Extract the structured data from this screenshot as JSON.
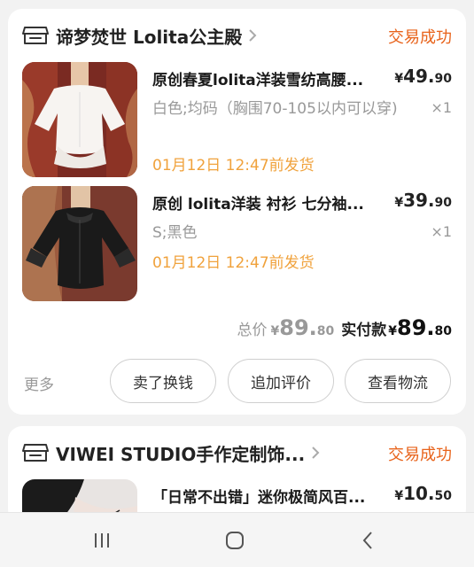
{
  "orders": [
    {
      "shop_name": "谛梦焚世  Lolita公主殿",
      "status": "交易成功",
      "items": [
        {
          "title": "原创春夏lolita洋装雪纺高腰...",
          "price_symbol": "¥",
          "price_int": "49.",
          "price_dec": "90",
          "spec": "白色;均码（胸围70-105以内可以穿)",
          "qty": "×1",
          "ship": "01月12日 12:47前发货"
        },
        {
          "title": "原创 lolita洋装 衬衫 七分袖...",
          "price_symbol": "¥",
          "price_int": "39.",
          "price_dec": "90",
          "spec": "S;黑色",
          "qty": "×1",
          "ship": "01月12日 12:47前发货"
        }
      ],
      "total_label": "总价",
      "total_symbol": "¥",
      "total_int": "89.",
      "total_dec": "80",
      "paid_label": "实付款",
      "paid_symbol": "¥",
      "paid_int": "89.",
      "paid_dec": "80",
      "more_label": "更多",
      "buttons": [
        "卖了换钱",
        "追加评价",
        "查看物流"
      ]
    },
    {
      "shop_name": "VIWEI STUDIO手作定制饰...",
      "status": "交易成功",
      "items": [
        {
          "title": "「日常不出错」迷你极简风百...",
          "price_symbol": "¥",
          "price_int": "10.",
          "price_dec": "50"
        }
      ]
    }
  ],
  "icons": {
    "shop": "shop-icon",
    "chevron": "chevron-right-icon",
    "nav_recent": "recent-apps-icon",
    "nav_home": "home-icon",
    "nav_back": "back-icon"
  },
  "colors": {
    "accent": "#e8631b",
    "ship": "#f0a23c",
    "muted": "#999999"
  }
}
